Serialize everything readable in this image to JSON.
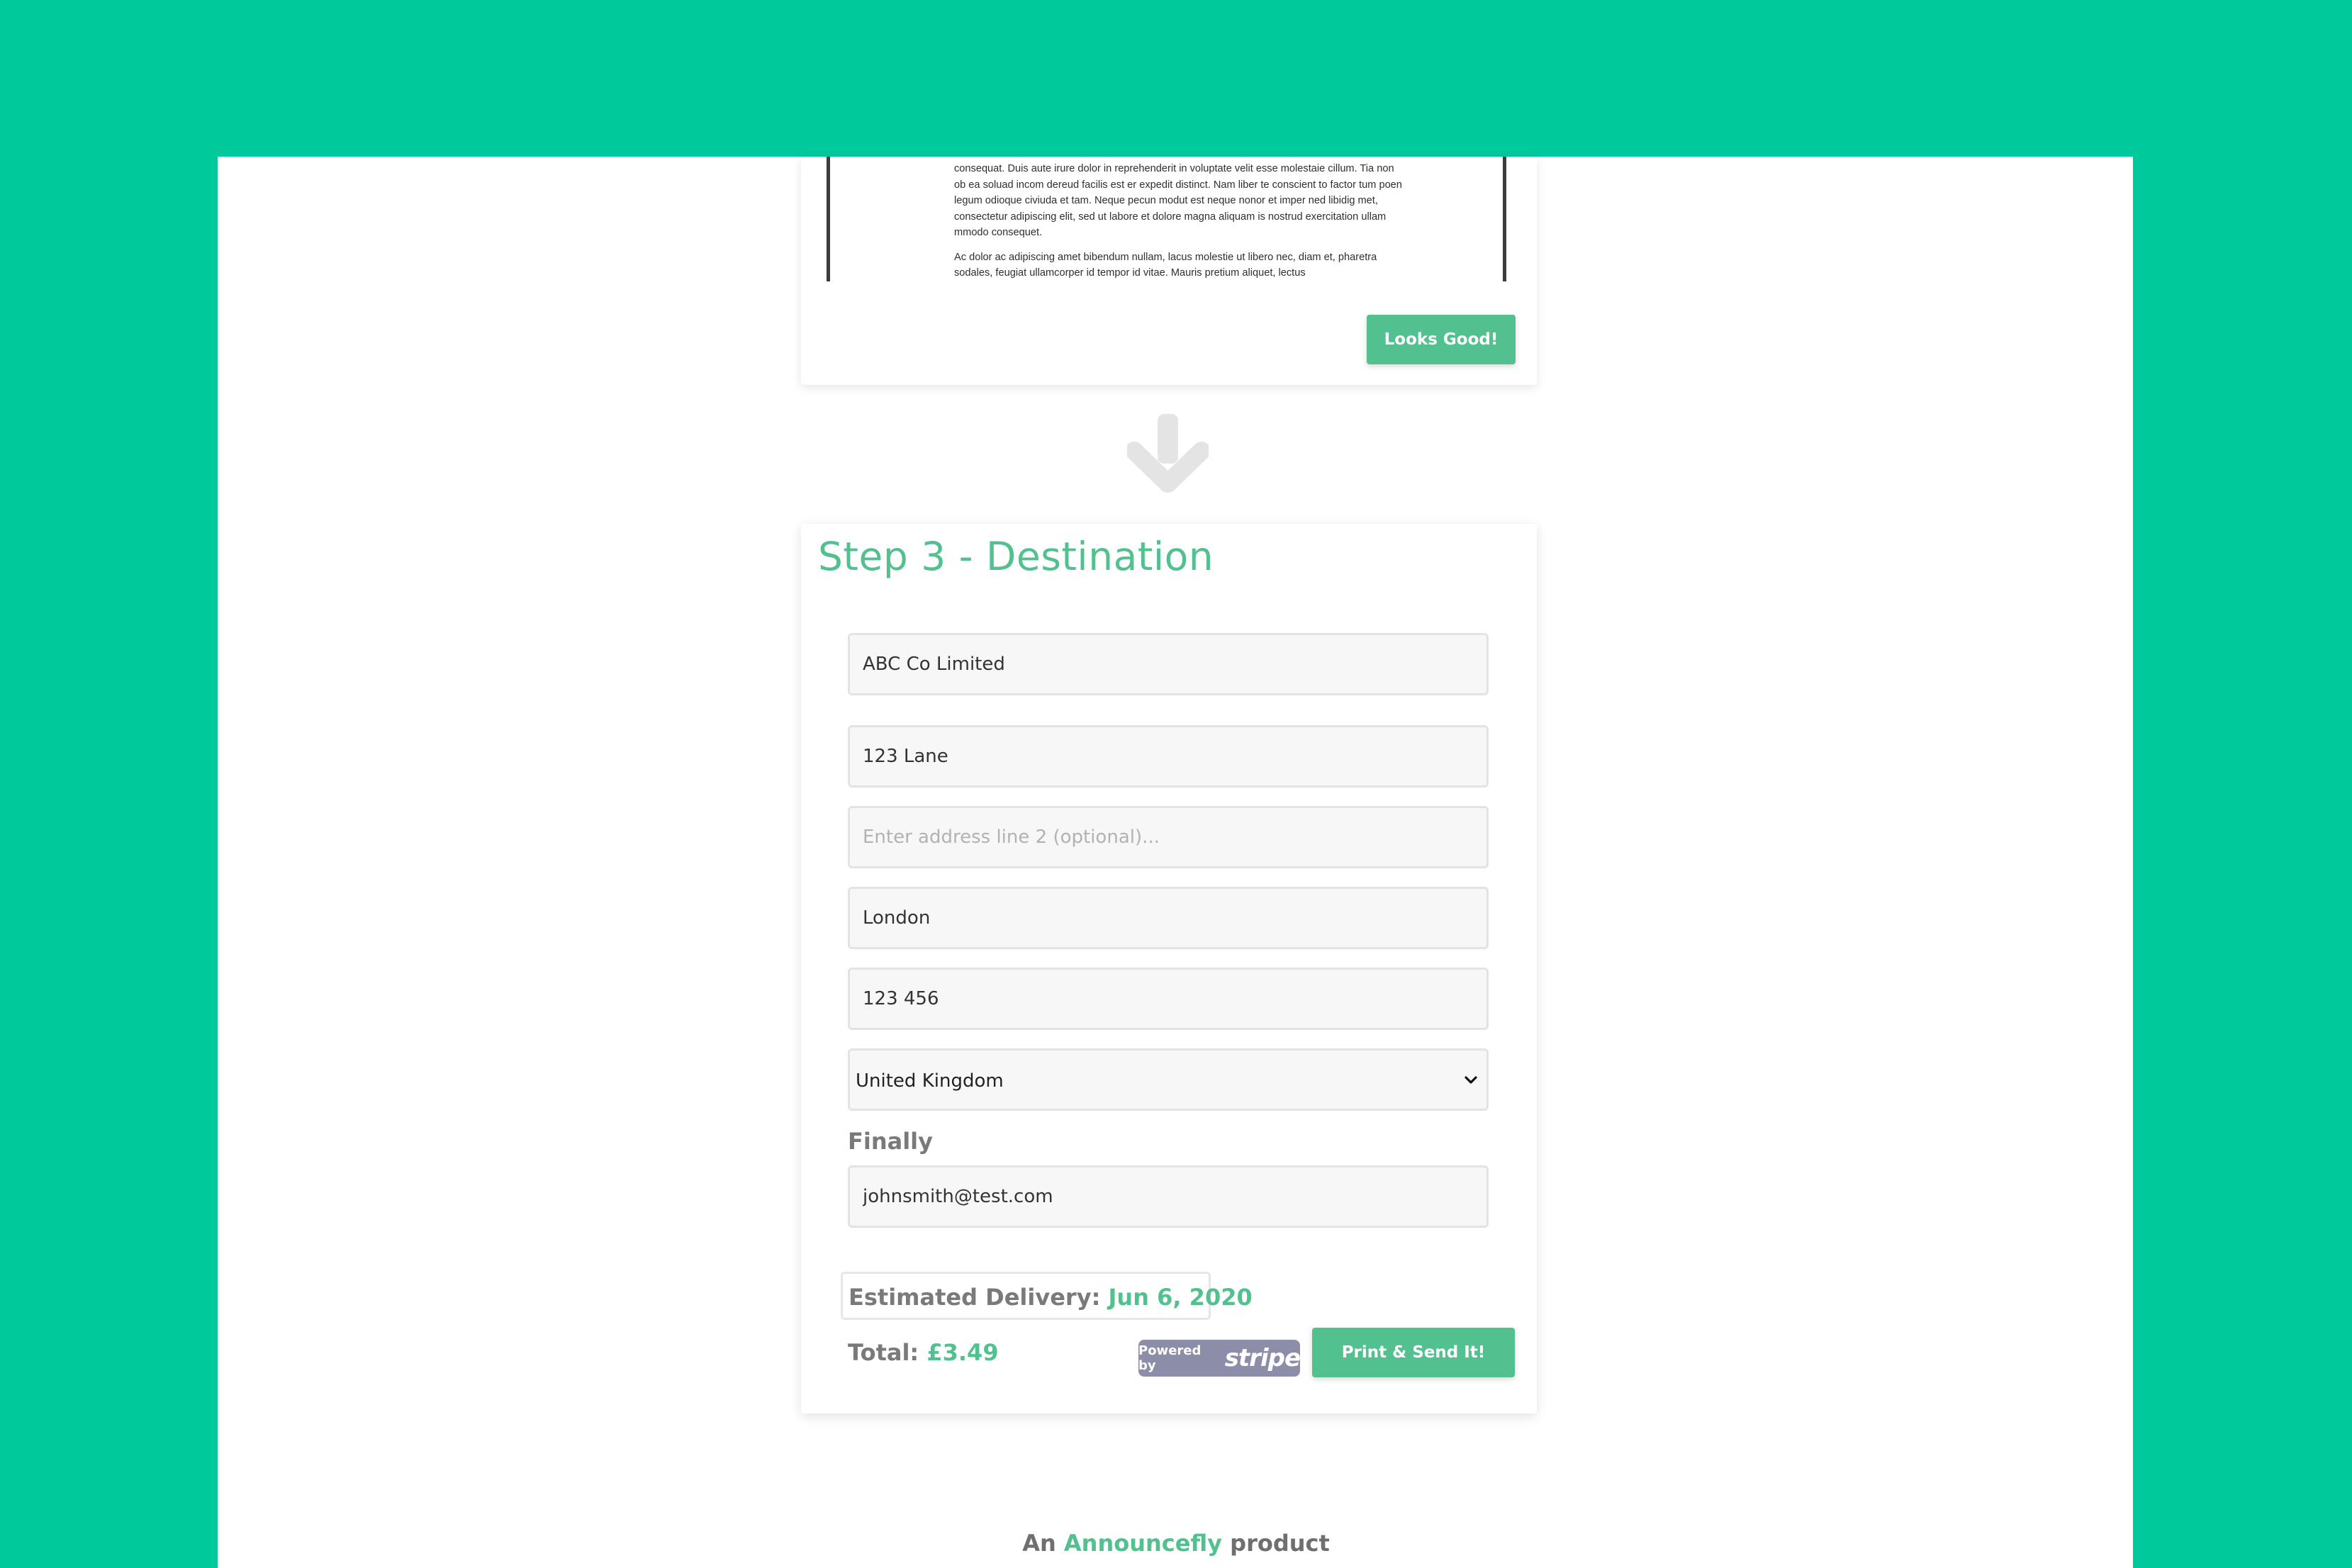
{
  "preview": {
    "paragraph1": "consequat. Duis aute irure dolor in reprehenderit in voluptate velit esse molestaie cillum. Tia non ob ea soluad incom dereud facilis est er expedit distinct. Nam liber te conscient to factor tum poen legum odioque civiuda et tam. Neque pecun modut est neque nonor et imper ned libidig met, consectetur adipiscing elit, sed ut labore et dolore magna aliquam is nostrud exercitation ullam mmodo consequet.",
    "paragraph2": "Ac dolor ac adipiscing amet bibendum nullam, lacus molestie ut libero nec, diam et, pharetra sodales, feugiat ullamcorper id tempor id vitae. Mauris pretium aliquet, lectus",
    "looks_good_label": "Looks Good!"
  },
  "destination": {
    "title": "Step 3 - Destination",
    "company": "ABC Co Limited",
    "address_line1": "123 Lane",
    "address_line2_placeholder": "Enter address line 2 (optional)...",
    "city": "London",
    "postcode": "123 456",
    "country": "United Kingdom",
    "finally_label": "Finally",
    "email": "johnsmith@test.com",
    "delivery_label": "Estimated Delivery:",
    "delivery_date": "Jun 6, 2020",
    "total_label": "Total:",
    "total_value": "£3.49",
    "stripe_powered": "Powered by",
    "stripe_brand": "stripe",
    "print_label": "Print & Send It!"
  },
  "footer": {
    "prefix": "An",
    "brand": "Announcefly",
    "suffix": "product"
  },
  "colors": {
    "background": "#00c99c",
    "accent": "#53c08f",
    "stripe": "#8c8da8"
  },
  "icons": {
    "arrow": "arrow-down-icon",
    "select": "chevron-down-icon"
  }
}
